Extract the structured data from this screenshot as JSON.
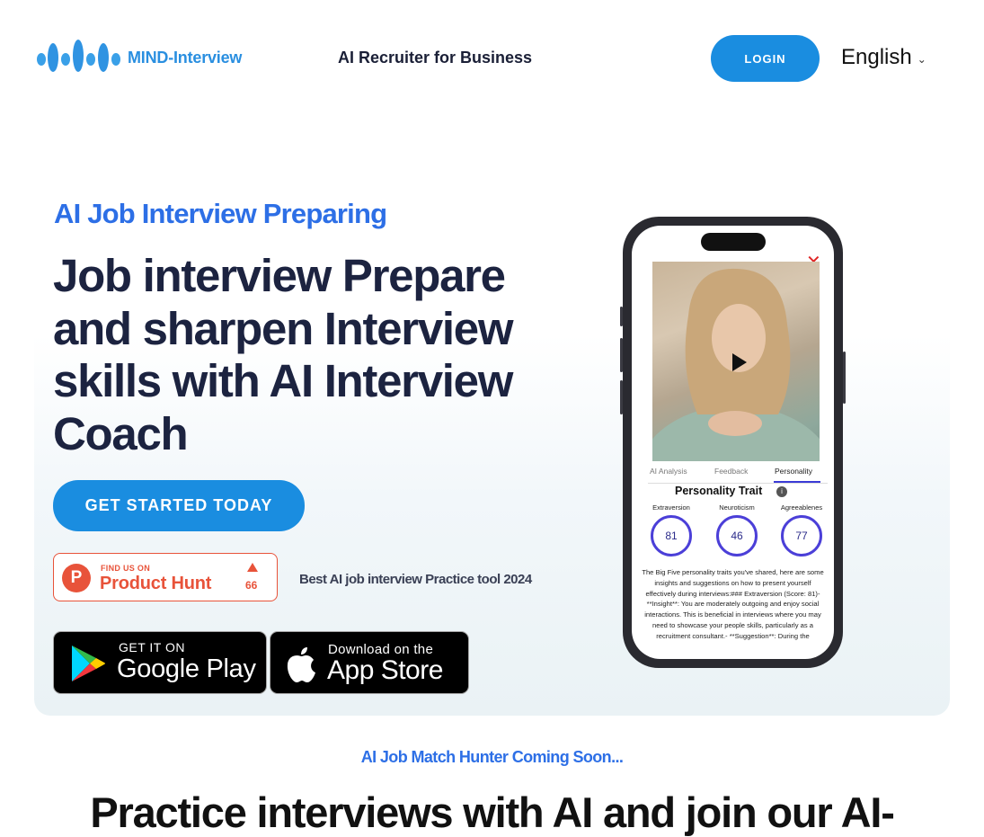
{
  "header": {
    "brand": "MIND-Interview",
    "nav_link": "AI Recruiter for Business",
    "login_label": "LOGIN",
    "language": "English",
    "accent_color": "#1a8de0"
  },
  "hero": {
    "eyebrow": "AI Job Interview Preparing",
    "headline": "Job interview Prepare and sharpen Interview skills with AI Interview Coach",
    "cta_label": "GET STARTED TODAY",
    "product_hunt": {
      "small": "FIND US ON",
      "big": "Product Hunt",
      "upvotes": "66",
      "color": "#e8533a"
    },
    "caption": "Best AI job interview Practice tool 2024",
    "google_play": {
      "small": "GET IT ON",
      "big": "Google Play"
    },
    "app_store": {
      "small": "Download on the",
      "big": "App Store"
    }
  },
  "phone": {
    "close_icon": "close-icon",
    "tabs": [
      "AI Analysis",
      "Feedback",
      "Personality"
    ],
    "active_tab": "Personality",
    "section_title": "Personality Trait",
    "traits": [
      {
        "label": "Extraversion",
        "score": "81"
      },
      {
        "label": "Neuroticism",
        "score": "46"
      },
      {
        "label": "Agreeablenes",
        "score": "77"
      }
    ],
    "body_text": "The Big Five personality traits you've shared, here are some insights and suggestions on how to present yourself effectively during interviews:### Extraversion (Score: 81)- **Insight**: You are moderately outgoing and enjoy social interactions. This is beneficial in interviews where you may need to showcase your people skills, particularly as a recruitment consultant.- **Suggestion**: During the"
  },
  "lower": {
    "coming_soon": "AI Job Match Hunter Coming Soon...",
    "title": "Practice interviews with AI and join our AI-"
  }
}
